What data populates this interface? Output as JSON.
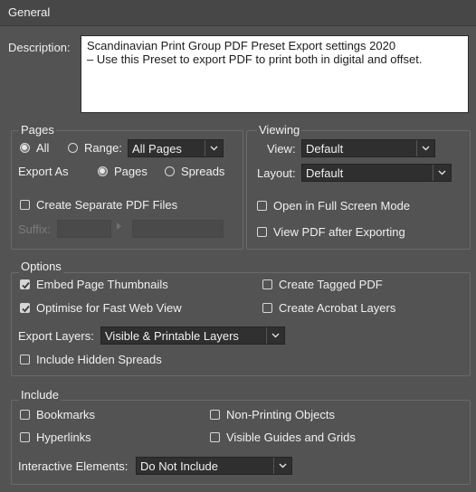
{
  "header": {
    "title": "General"
  },
  "description": {
    "label": "Description:",
    "lines": [
      "Scandinavian Print Group PDF Preset Export settings 2020",
      "– Use this Preset to export PDF to print both in digital and offset."
    ]
  },
  "pages": {
    "title": "Pages",
    "all_label": "All",
    "range_label": "Range:",
    "range_value": "All Pages",
    "range_selected": "all",
    "export_as_label": "Export As",
    "pages_option": "Pages",
    "spreads_option": "Spreads",
    "export_as_selected": "pages",
    "separate_files_label": "Create Separate PDF Files",
    "separate_files_checked": false,
    "suffix_label": "Suffix:"
  },
  "viewing": {
    "title": "Viewing",
    "view_label": "View:",
    "view_value": "Default",
    "layout_label": "Layout:",
    "layout_value": "Default",
    "full_screen_label": "Open in Full Screen Mode",
    "full_screen_checked": false,
    "view_after_label": "View PDF after Exporting",
    "view_after_checked": false
  },
  "options": {
    "title": "Options",
    "embed_thumbnails_label": "Embed Page Thumbnails",
    "embed_thumbnails_checked": true,
    "optimise_label": "Optimise for Fast Web View",
    "optimise_checked": true,
    "tagged_pdf_label": "Create Tagged PDF",
    "tagged_pdf_checked": false,
    "acrobat_layers_label": "Create Acrobat Layers",
    "acrobat_layers_checked": false,
    "export_layers_label": "Export Layers:",
    "export_layers_value": "Visible & Printable Layers",
    "hidden_spreads_label": "Include Hidden Spreads",
    "hidden_spreads_checked": false
  },
  "include": {
    "title": "Include",
    "bookmarks_label": "Bookmarks",
    "hyperlinks_label": "Hyperlinks",
    "non_printing_label": "Non-Printing Objects",
    "guides_grids_label": "Visible Guides and Grids",
    "interactive_label": "Interactive Elements:",
    "interactive_value": "Do Not Include"
  },
  "colors": {
    "panel_bg": "#535353",
    "header_bg": "#474747",
    "field_bg": "#2f2f2f",
    "text": "#f0f0f0"
  }
}
